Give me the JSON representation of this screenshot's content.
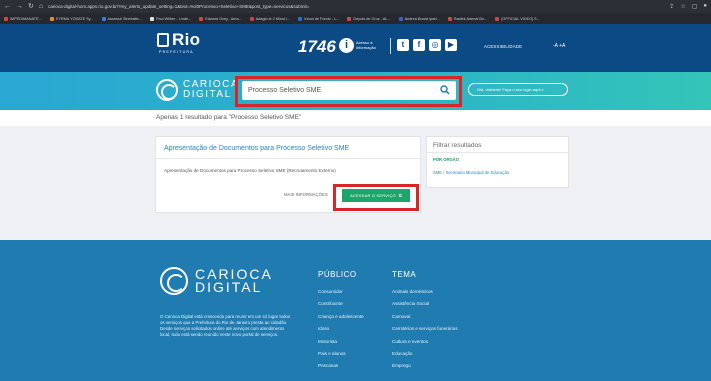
{
  "browser": {
    "url": "carioca-digital-hom.apps.rio.gov.br/?my_alerts_update_setting=1&text=%20Processo+Seletivo+SME&post_type=servicos&submit=",
    "bookmarks": [
      "IMPEDIMANATE...",
      "SYRMA YOSATE Sy...",
      "Assessir Sinetrátic...",
      "Paul Wilber - Linde...",
      "Edward Greg - Ama...",
      "Adagio le 2 Minut I...",
      "Intool de Fondo - L...",
      "Depois de Cruz - AL...",
      "Andrea Boará Ipart...",
      "Radiek Adenal Bo...",
      "[OFFICIAL VIDEO] S..."
    ]
  },
  "header": {
    "logo_name": "Rio",
    "logo_sub": "PREFEITURA",
    "number": "1746",
    "acesso_line1": "Acesso à",
    "acesso_line2": "informação",
    "social": [
      "t",
      "f",
      "◎",
      "▶"
    ],
    "acessibilidade": "ACESSIBILIDADE",
    "font_controls": "-A +A"
  },
  "carioca": {
    "line1": "CARIOCA",
    "line2": "DIGITAL",
    "search_value": "Processo Seletivo SME",
    "greeting": "Olá, visitante! Faça o seu login aqui ▾"
  },
  "results": {
    "count_text": "Apenas 1 resultado para \"Processo Seletivo SME\"",
    "card_title": "Apresentação de Documentos para Processo Seletivo SME",
    "card_desc": "Apresentação de Documentos para Processo Seletivo SME (Recrutamento Externo)",
    "mais_label": "MAIS INFORMAÇÕES",
    "acessar_label": "ACESSAR O SERVIÇO",
    "filter_title": "Filtrar resultados",
    "filter_org": "POR ORGÃO",
    "filter_item": "SME / Secretaria Municipal de Educação"
  },
  "footer": {
    "line1": "CARIOCA",
    "line2": "DIGITAL",
    "about": "O Carioca Digital está crescendo para reunir em um só lugar todos os serviços que a Prefeitura do Rio de Janeiro presta ao cidadão. Desde serviços solicitados online até serviços com atendimento local, tudo está sendo reunido neste novo portal de serviços.",
    "col1_head": "PÚBLICO",
    "col1": [
      "Consumidor",
      "Contribuinte",
      "Criança e adolescente",
      "Idoso",
      "Motorista",
      "Pais e alunos",
      "Pescanas"
    ],
    "col2_head": "TEMA",
    "col2": [
      "Animais domésticos",
      "Assistência Social",
      "Carnaval",
      "Cemitérios e serviços funerários",
      "Cultura e eventos",
      "Educação",
      "Emprego"
    ]
  },
  "colors": {
    "header_blue": "#0c4a86",
    "carioca_gradient_start": "#2aa7d2",
    "carioca_gradient_end": "#34c4b8",
    "highlight_red": "#d6262a",
    "button_green": "#1aa76b",
    "footer_blue": "#1f7bb0"
  }
}
